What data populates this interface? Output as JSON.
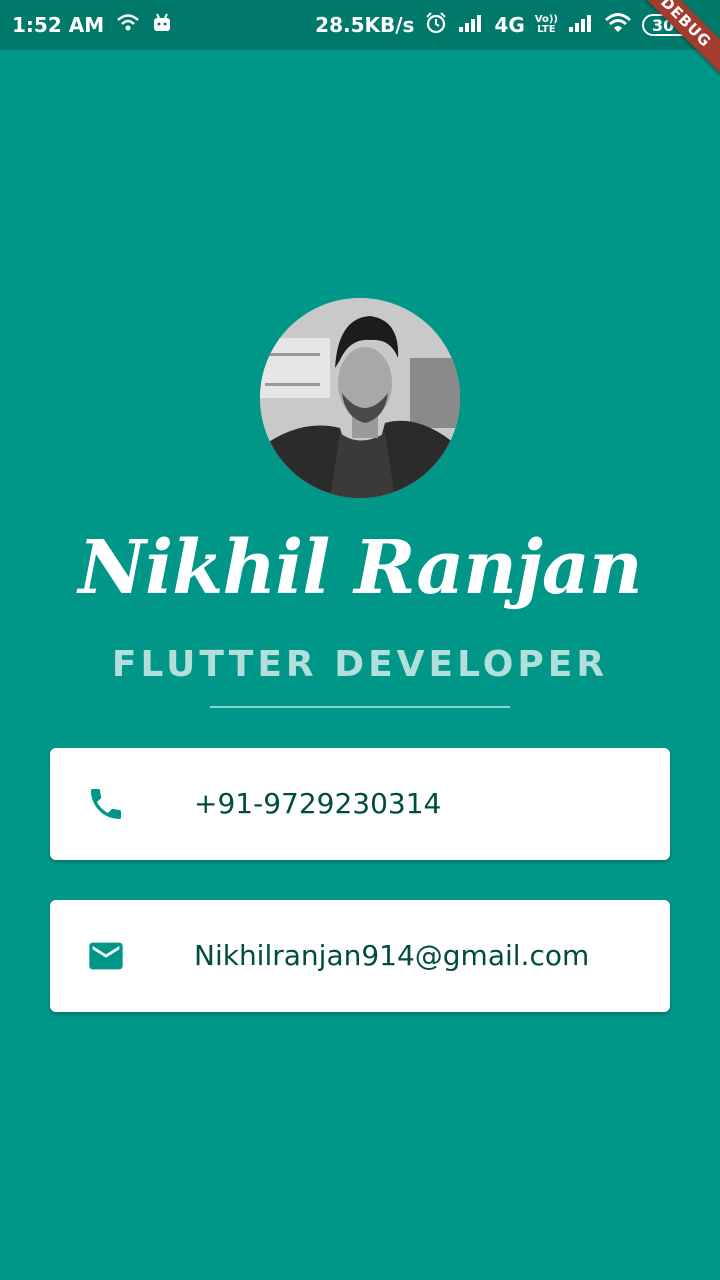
{
  "status_bar": {
    "time": "1:52 AM",
    "speed": "28.5KB/s",
    "network": "4G",
    "volte": "Vo))",
    "lte": "LTE",
    "battery": "30",
    "icons": [
      "wifi-icon",
      "android-icon",
      "alarm-icon",
      "signal-icon",
      "signal-icon-2",
      "wifi-icon-2",
      "battery-icon"
    ]
  },
  "debug_banner": "DEBUG",
  "profile": {
    "name": "Nikhil Ranjan",
    "title": "FLUTTER DEVELOPER"
  },
  "contacts": {
    "phone": "+91-9729230314",
    "email": "Nikhilranjan914@gmail.com"
  },
  "colors": {
    "background": "#009688",
    "status_bar": "#00796B",
    "card_text": "#004D40",
    "icon": "#009688",
    "subtitle": "#B2DFDB"
  }
}
